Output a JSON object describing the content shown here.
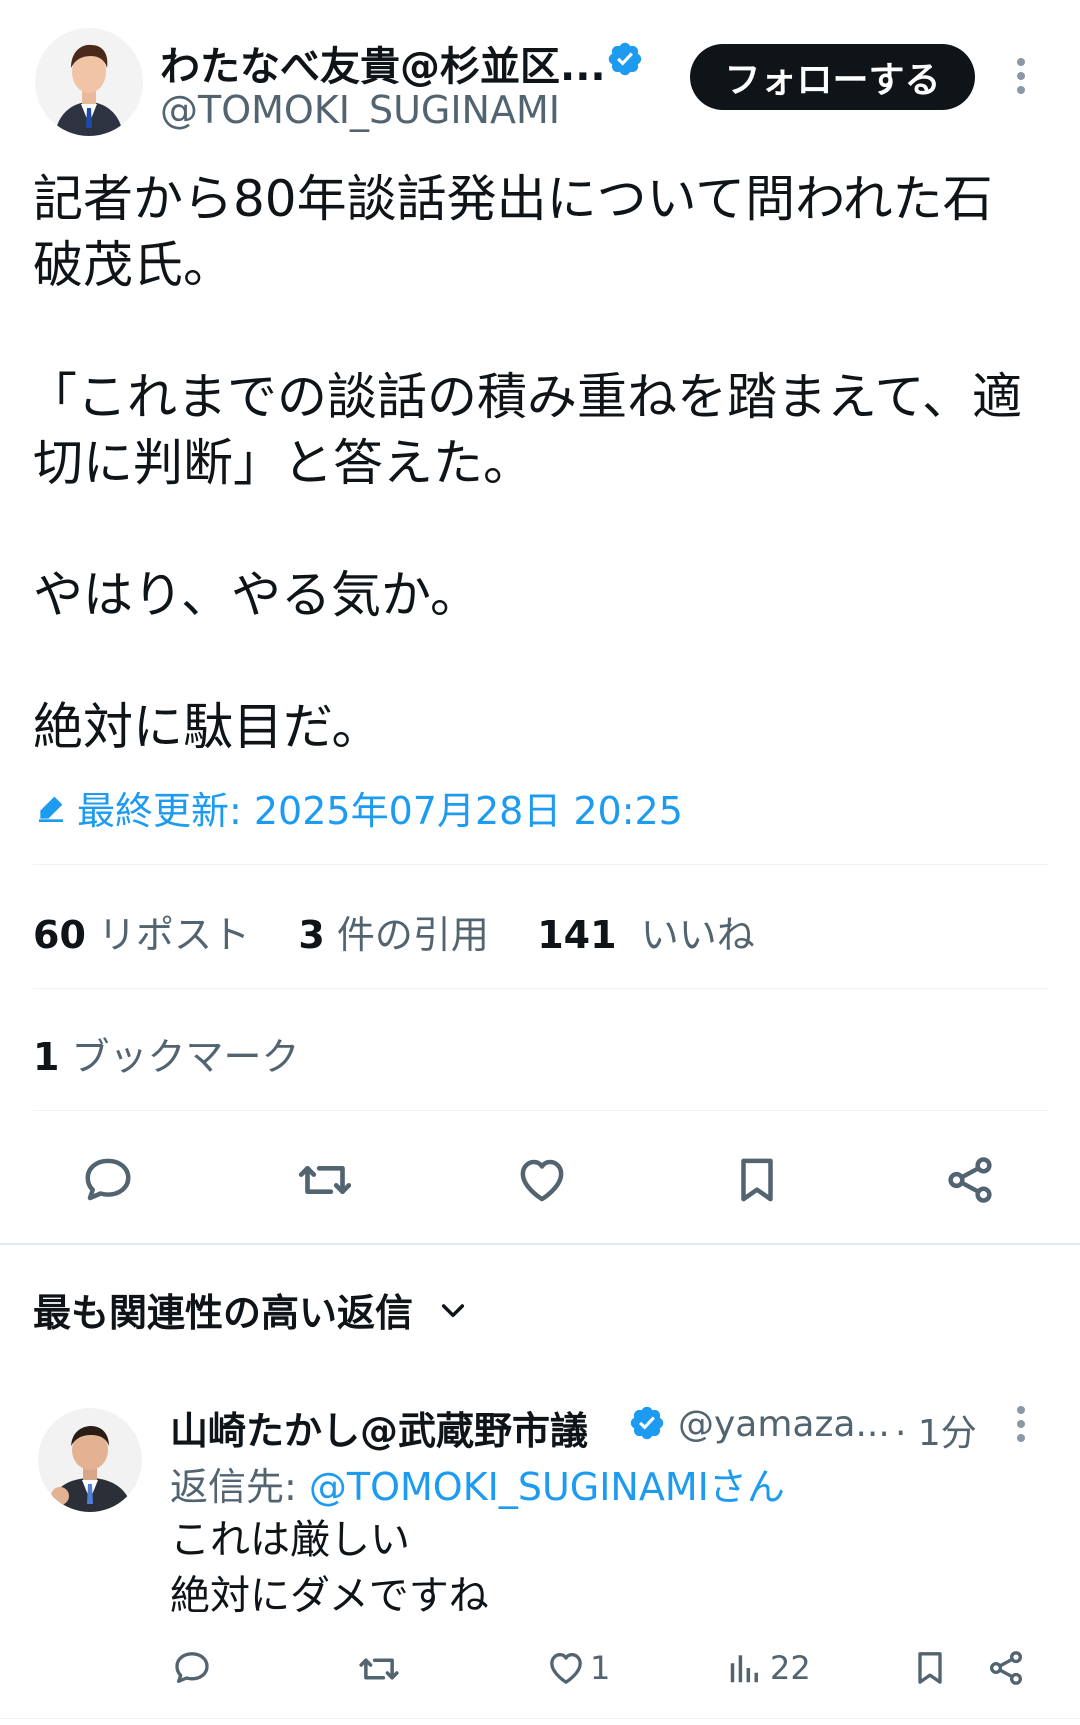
{
  "author": {
    "display_name": "わたなべ友貴@杉並区...",
    "handle": "@TOMOKI_SUGINAMI",
    "follow_label": "フォローする"
  },
  "tweet": {
    "lines": [
      "記者から80年談話発出について問われた石",
      "破茂氏。",
      "",
      "「これまでの談話の積み重ねを踏まえて、適",
      "切に判断」と答えた。",
      "",
      "やはり、やる気か。",
      "",
      "絶対に駄目だ。"
    ],
    "edited_label": "最終更新: 2025年07月28日 20:25"
  },
  "stats": {
    "reposts_count": "60",
    "reposts_label": "リポスト",
    "quotes_count": "3",
    "quotes_label": "件の引用",
    "likes_count": "141",
    "likes_label": "いいね",
    "bookmarks_count": "1",
    "bookmarks_label": "ブックマーク"
  },
  "replies_section": {
    "title": "最も関連性の高い返信"
  },
  "reply": {
    "display_name": "山崎たかし@武蔵野市議",
    "handle": "@yamaza...",
    "time": "· 1分",
    "reply_to_prefix": "返信先: ",
    "reply_to_handle": "@TOMOKI_SUGINAMIさん",
    "lines": [
      "これは厳しい",
      "絶対にダメですね"
    ],
    "like_count": "1",
    "views_count": "22"
  },
  "colors": {
    "accent": "#1d9bf0",
    "text": "#0f1419",
    "muted": "#536471",
    "follow_bg": "#0f1419"
  },
  "icons": [
    "verified-badge-icon",
    "more-icon",
    "edit-pencil-icon",
    "reply-icon",
    "repost-icon",
    "like-icon",
    "bookmark-icon",
    "share-icon",
    "chevron-down-icon",
    "views-icon"
  ]
}
